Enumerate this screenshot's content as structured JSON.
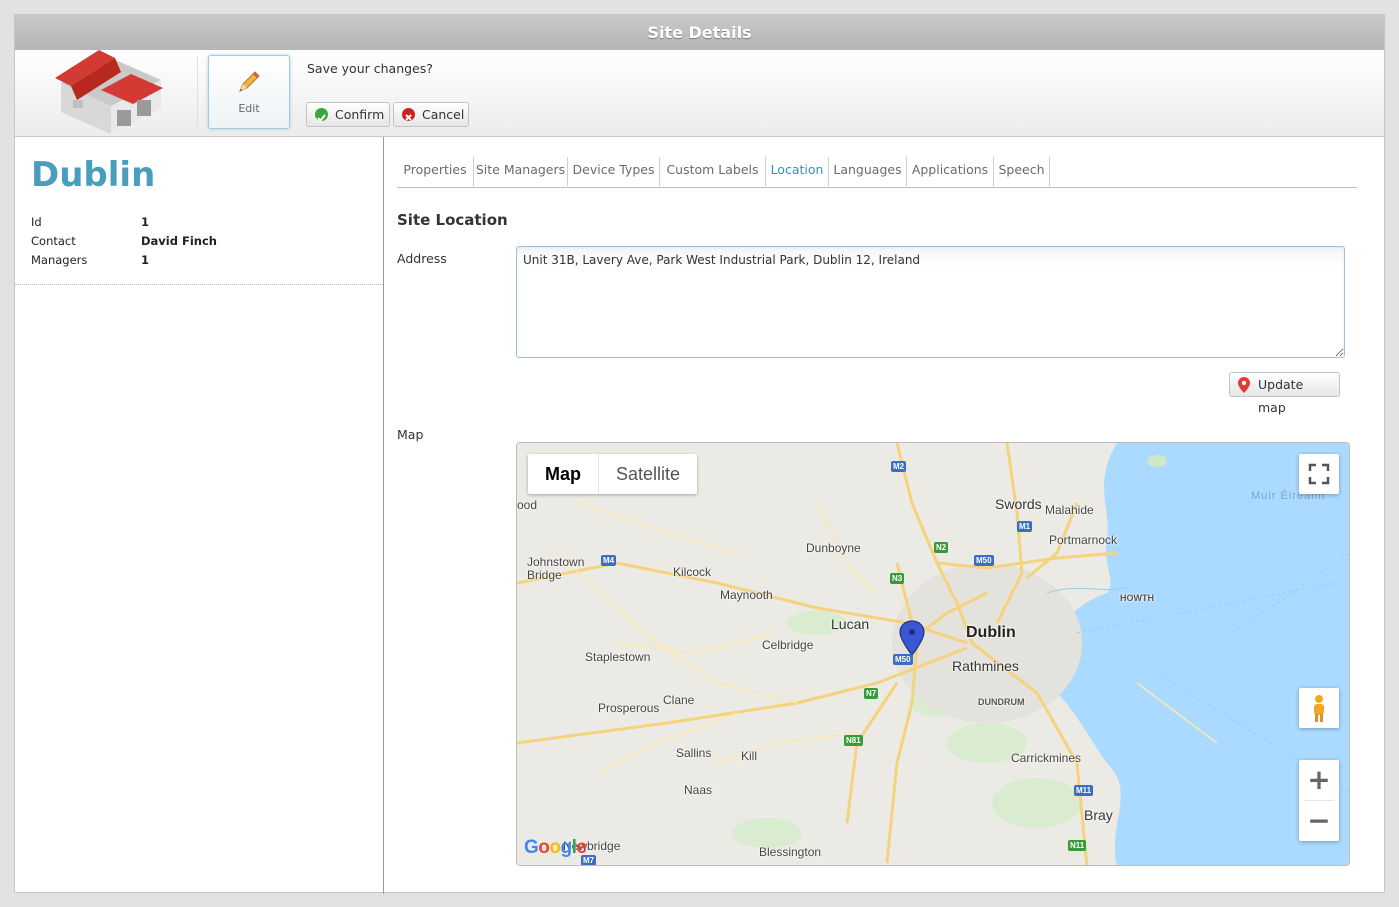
{
  "window": {
    "title": "Site Details"
  },
  "toolbar": {
    "edit_label": "Edit",
    "prompt": "Save your changes?",
    "confirm_label": "Confirm",
    "cancel_label": "Cancel"
  },
  "site": {
    "name": "Dublin",
    "fields": [
      {
        "key": "Id",
        "value": "1"
      },
      {
        "key": "Contact",
        "value": "David Finch"
      },
      {
        "key": "Managers",
        "value": "1"
      }
    ]
  },
  "tabs": [
    {
      "label": "Properties",
      "active": false
    },
    {
      "label": "Site Managers",
      "active": false
    },
    {
      "label": "Device Types",
      "active": false
    },
    {
      "label": "Custom Labels",
      "active": false
    },
    {
      "label": "Location",
      "active": true
    },
    {
      "label": "Languages",
      "active": false
    },
    {
      "label": "Applications",
      "active": false
    },
    {
      "label": "Speech",
      "active": false
    }
  ],
  "location": {
    "section_title": "Site Location",
    "address_label": "Address",
    "address_value": "Unit 31B, Lavery Ave, Park West Industrial Park, Dublin 12, Ireland",
    "update_button": "Update map",
    "map_label": "Map"
  },
  "map": {
    "type_options": [
      "Map",
      "Satellite"
    ],
    "selected_type": "Map",
    "provider_logo": "Google",
    "places": [
      "Swords",
      "Malahide",
      "Portmarnock",
      "HOWTH",
      "Dunboyne",
      "Johnstown Bridge",
      "Kilcock",
      "Maynooth",
      "Lucan",
      "Dublin",
      "Rathmines",
      "Celbridge",
      "Staplestown",
      "DUNDRUM",
      "Clane",
      "Prosperous",
      "Sallins",
      "Kill",
      "Naas",
      "Carrickmines",
      "Bray",
      "Newbridge",
      "Blessington",
      "Muir Éireann",
      "ood"
    ],
    "roads": [
      "M2",
      "M1",
      "N2",
      "M50",
      "N3",
      "M4",
      "M50",
      "N7",
      "N81",
      "M11",
      "N11",
      "M7"
    ],
    "controls": [
      "fullscreen-icon",
      "pegman-icon",
      "zoom-in-icon",
      "zoom-out-icon"
    ]
  },
  "colors": {
    "accent": "#4a9ebd",
    "tab_active": "#3f8db7",
    "confirm": "#3aa53a",
    "cancel": "#cc2222",
    "sea": "#aadaff",
    "land": "#eceae4"
  }
}
